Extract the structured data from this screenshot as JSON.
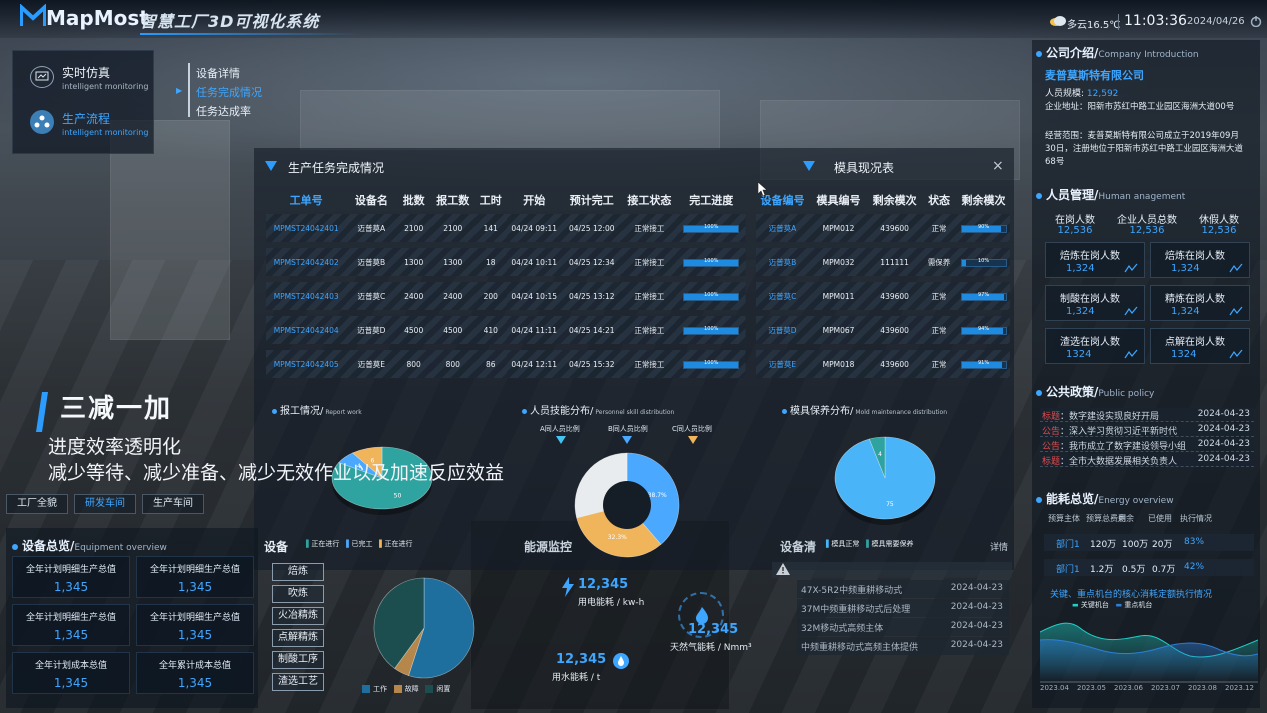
{
  "header": {
    "logo": "MapMost",
    "title": "智慧工厂3D可视化系统",
    "weather": "多云16.5℃",
    "time": "11:03:36",
    "date": "2024/04/26"
  },
  "nav_left": {
    "items": [
      {
        "label": "实时仿真",
        "sub": "intelligent monitoring"
      },
      {
        "label": "生产流程",
        "sub": "intelligent monitoring"
      }
    ],
    "sub_items": [
      "设备详情",
      "任务完成情况",
      "任务达成率"
    ]
  },
  "company": {
    "title": "公司介绍/",
    "title_en": "Company Introduction",
    "name": "麦普莫斯特有限公司",
    "scale_label": "人员规模:",
    "scale_value": "12,592",
    "address": "企业地址：阳新市苏红中路工业园区海洲大道00号",
    "scope": "经营范围：麦普莫斯特有限公司成立于2019年09月30日，注册地位于阳新市苏红中路工业园区海洲大道68号"
  },
  "hr": {
    "title": "人员管理/",
    "title_en": "Human anagement",
    "top": [
      {
        "label": "在岗人数",
        "value": "12,536"
      },
      {
        "label": "企业人员总数",
        "value": "12,536"
      },
      {
        "label": "休假人数",
        "value": "12,536"
      }
    ],
    "cards": [
      {
        "label": "焙炼在岗人数",
        "value": "1,324"
      },
      {
        "label": "焙炼在岗人数",
        "value": "1,324"
      },
      {
        "label": "制酸在岗人数",
        "value": "1,324"
      },
      {
        "label": "精炼在岗人数",
        "value": "1,324"
      },
      {
        "label": "渣选在岗人数",
        "value": "1324"
      },
      {
        "label": "点解在岗人数",
        "value": "1324"
      }
    ]
  },
  "policy": {
    "title": "公共政策/",
    "title_en": "Public policy",
    "items": [
      {
        "tag": "标题",
        "text": "数字建设实现良好开局",
        "date": "2024-04-23"
      },
      {
        "tag": "公告",
        "text": "深入学习贯彻习近平新时代",
        "date": "2024-04-23"
      },
      {
        "tag": "公告",
        "text": "我市成立了数字建设领导小组",
        "date": "2024-04-23"
      },
      {
        "tag": "标题",
        "text": "全市大数据发展相关负责人",
        "date": "2024-04-23"
      }
    ]
  },
  "energy": {
    "title": "能耗总览/",
    "title_en": "Energy overview",
    "headers": [
      "预算主体",
      "预算总费用",
      "剩余",
      "已使用",
      "执行情况"
    ],
    "rows": [
      {
        "name": "部门1",
        "total": "120万",
        "remain": "100万",
        "used": "20万",
        "pct": "83%"
      },
      {
        "name": "部门1",
        "total": "1.2万",
        "remain": "0.5万",
        "used": "0.7万",
        "pct": "42%"
      }
    ],
    "chart_title": "关键、重点机台的核心消耗定额执行情况",
    "legend": [
      "关键机台",
      "重点机台"
    ],
    "x_ticks": [
      "2023.04",
      "2023.05",
      "2023.06",
      "2023.07",
      "2023.08",
      "2023.12"
    ]
  },
  "tasks": {
    "title": "生产任务完成情况",
    "headers": [
      "工单号",
      "设备名",
      "批数",
      "报工数",
      "工时",
      "开始",
      "预计完工",
      "接工状态",
      "完工进度"
    ],
    "rows": [
      {
        "id": "MPMST24042401",
        "dev": "迈普莫A",
        "batch": "2100",
        "report": "2100",
        "hours": "141",
        "start": "04/24 09:11",
        "end": "04/25 12:00",
        "status": "正常接工",
        "progress": "100%",
        "pct": 100
      },
      {
        "id": "MPMST24042402",
        "dev": "迈普莫B",
        "batch": "1300",
        "report": "1300",
        "hours": "18",
        "start": "04/24 10:11",
        "end": "04/25 12:34",
        "status": "正常接工",
        "progress": "100%",
        "pct": 100
      },
      {
        "id": "MPMST24042403",
        "dev": "迈普莫C",
        "batch": "2400",
        "report": "2400",
        "hours": "200",
        "start": "04/24 10:15",
        "end": "04/25 13:12",
        "status": "正常接工",
        "progress": "100%",
        "pct": 100
      },
      {
        "id": "MPMST24042404",
        "dev": "迈普莫D",
        "batch": "4500",
        "report": "4500",
        "hours": "410",
        "start": "04/24 11:11",
        "end": "04/25 14:21",
        "status": "正常接工",
        "progress": "100%",
        "pct": 100
      },
      {
        "id": "MPMST24042405",
        "dev": "迈普莫E",
        "batch": "800",
        "report": "800",
        "hours": "86",
        "start": "04/24 12:11",
        "end": "04/25 15:32",
        "status": "正常接工",
        "progress": "100%",
        "pct": 100
      }
    ]
  },
  "molds": {
    "title": "模具现况表",
    "headers": [
      "设备编号",
      "模具编号",
      "剩余模次",
      "状态",
      "剩余模次"
    ],
    "rows": [
      {
        "dev": "迈普莫A",
        "mold": "MPM012",
        "remain": "439600",
        "state": "正常",
        "pct_label": "90%",
        "pct": 90
      },
      {
        "dev": "迈普莫B",
        "mold": "MPM032",
        "remain": "111111",
        "state": "需保养",
        "pct_label": "10%",
        "pct": 10
      },
      {
        "dev": "迈普莫C",
        "mold": "MPM011",
        "remain": "439600",
        "state": "正常",
        "pct_label": "97%",
        "pct": 97
      },
      {
        "dev": "迈普莫D",
        "mold": "MPM067",
        "remain": "439600",
        "state": "正常",
        "pct_label": "94%",
        "pct": 94
      },
      {
        "dev": "迈普莫E",
        "mold": "MPM018",
        "remain": "439600",
        "state": "正常",
        "pct_label": "91%",
        "pct": 91
      }
    ]
  },
  "report": {
    "title": "报工情况/",
    "title_en": "Report work",
    "legend": [
      "正在进行",
      "已完工",
      "正在进行"
    ]
  },
  "skills": {
    "title": "人员技能分布/",
    "title_en": "Personnel skill distribution",
    "cats": [
      "A同人员比例",
      "B同人员比例",
      "C同人员比例"
    ]
  },
  "maint": {
    "title": "模具保养分布/",
    "title_en": "Mold maintenance distribution",
    "legend": [
      "模具正常",
      "模具需要保养"
    ]
  },
  "chart_data": [
    {
      "type": "pie",
      "title": "报工情况",
      "values": [
        50,
        4,
        6
      ],
      "labels": [
        "50",
        "4",
        "6"
      ],
      "colors": [
        "#2fa3a0",
        "#4aa8ff",
        "#f0b45a"
      ]
    },
    {
      "type": "pie",
      "title": "人员技能分布",
      "values": [
        38.7,
        32.3,
        29
      ],
      "labels": [
        "38.7%",
        "32.3%",
        ""
      ],
      "colors": [
        "#4aa8ff",
        "#f0b45a",
        "#e9ecef"
      ]
    },
    {
      "type": "pie",
      "title": "模具保养分布",
      "values": [
        75,
        4
      ],
      "labels": [
        "75",
        "4"
      ],
      "colors": [
        "#4ab4f8",
        "#2fa3a0"
      ]
    },
    {
      "type": "pie",
      "title": "设备",
      "values": [
        55,
        5,
        40
      ],
      "labels": [
        "",
        "",
        ""
      ],
      "colors": [
        "#1f6f9e",
        "#b5874b",
        "#1d4e4f"
      ]
    }
  ],
  "slogan": {
    "title": "三减一加",
    "line1": "进度效率透明化",
    "line2": "减少等待、减少准备、减少无效作业以及加速反应效益"
  },
  "tabs": [
    "工厂全貌",
    "研发车间",
    "生产车间"
  ],
  "equipment": {
    "title": "设备总览/",
    "title_en": "Equipment overview",
    "cells": [
      {
        "label": "全年计划明细生产总值",
        "value": "1,345"
      },
      {
        "label": "全年计划明细生产总值",
        "value": "1,345"
      },
      {
        "label": "全年计划明细生产总值",
        "value": "1,345"
      },
      {
        "label": "全年计划明细生产总值",
        "value": "1,345"
      },
      {
        "label": "全年计划成本总值",
        "value": "1,345"
      },
      {
        "label": "全年累计成本总值",
        "value": "1,345"
      }
    ]
  },
  "process": {
    "title": "设备",
    "buttons": [
      "焙炼",
      "吹炼",
      "火冶精炼",
      "点解精炼",
      "制酸工序",
      "渣选工艺"
    ],
    "legend": [
      "工作",
      "故障",
      "闲置"
    ]
  },
  "energy_monitor": {
    "title": "能源监控",
    "items": [
      {
        "value": "12,345",
        "label": "用电能耗 / kw-h"
      },
      {
        "value": "12,345",
        "label": "天然气能耗 / Nmm³"
      },
      {
        "value": "12,345",
        "label": "用水能耗 / t"
      }
    ]
  },
  "device_list": {
    "title": "设备清",
    "link": "详情",
    "items": [
      {
        "text": "47X-5R2中频重耕移动式",
        "date": "2024-04-23"
      },
      {
        "text": "37M中频重耕移动式后处理",
        "date": "2024-04-23"
      },
      {
        "text": "32M移动式高频主体",
        "date": "2024-04-23"
      },
      {
        "text": "中频重耕移动式高频主体提供",
        "date": "2024-04-23"
      }
    ]
  },
  "close_icon": "×"
}
